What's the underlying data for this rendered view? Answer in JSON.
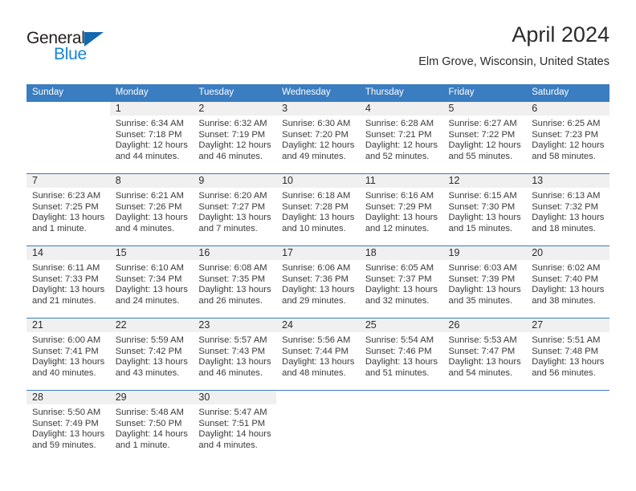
{
  "brand": {
    "name_part1": "General",
    "name_part2": "Blue",
    "accent_color": "#1583d4",
    "triangle_color": "#1269b0"
  },
  "header": {
    "title": "April 2024",
    "subtitle": "Elm Grove, Wisconsin, United States"
  },
  "theme": {
    "header_row_bg": "#3a7dc0",
    "daynum_band_bg": "#f0f0f0",
    "row_divider": "#3a7dc0"
  },
  "weekday_headers": [
    "Sunday",
    "Monday",
    "Tuesday",
    "Wednesday",
    "Thursday",
    "Friday",
    "Saturday"
  ],
  "weeks": [
    [
      {
        "day": "",
        "sunrise": "",
        "sunset": "",
        "daylight_line1": "",
        "daylight_line2": ""
      },
      {
        "day": "1",
        "sunrise": "Sunrise: 6:34 AM",
        "sunset": "Sunset: 7:18 PM",
        "daylight_line1": "Daylight: 12 hours",
        "daylight_line2": "and 44 minutes."
      },
      {
        "day": "2",
        "sunrise": "Sunrise: 6:32 AM",
        "sunset": "Sunset: 7:19 PM",
        "daylight_line1": "Daylight: 12 hours",
        "daylight_line2": "and 46 minutes."
      },
      {
        "day": "3",
        "sunrise": "Sunrise: 6:30 AM",
        "sunset": "Sunset: 7:20 PM",
        "daylight_line1": "Daylight: 12 hours",
        "daylight_line2": "and 49 minutes."
      },
      {
        "day": "4",
        "sunrise": "Sunrise: 6:28 AM",
        "sunset": "Sunset: 7:21 PM",
        "daylight_line1": "Daylight: 12 hours",
        "daylight_line2": "and 52 minutes."
      },
      {
        "day": "5",
        "sunrise": "Sunrise: 6:27 AM",
        "sunset": "Sunset: 7:22 PM",
        "daylight_line1": "Daylight: 12 hours",
        "daylight_line2": "and 55 minutes."
      },
      {
        "day": "6",
        "sunrise": "Sunrise: 6:25 AM",
        "sunset": "Sunset: 7:23 PM",
        "daylight_line1": "Daylight: 12 hours",
        "daylight_line2": "and 58 minutes."
      }
    ],
    [
      {
        "day": "7",
        "sunrise": "Sunrise: 6:23 AM",
        "sunset": "Sunset: 7:25 PM",
        "daylight_line1": "Daylight: 13 hours",
        "daylight_line2": "and 1 minute."
      },
      {
        "day": "8",
        "sunrise": "Sunrise: 6:21 AM",
        "sunset": "Sunset: 7:26 PM",
        "daylight_line1": "Daylight: 13 hours",
        "daylight_line2": "and 4 minutes."
      },
      {
        "day": "9",
        "sunrise": "Sunrise: 6:20 AM",
        "sunset": "Sunset: 7:27 PM",
        "daylight_line1": "Daylight: 13 hours",
        "daylight_line2": "and 7 minutes."
      },
      {
        "day": "10",
        "sunrise": "Sunrise: 6:18 AM",
        "sunset": "Sunset: 7:28 PM",
        "daylight_line1": "Daylight: 13 hours",
        "daylight_line2": "and 10 minutes."
      },
      {
        "day": "11",
        "sunrise": "Sunrise: 6:16 AM",
        "sunset": "Sunset: 7:29 PM",
        "daylight_line1": "Daylight: 13 hours",
        "daylight_line2": "and 12 minutes."
      },
      {
        "day": "12",
        "sunrise": "Sunrise: 6:15 AM",
        "sunset": "Sunset: 7:30 PM",
        "daylight_line1": "Daylight: 13 hours",
        "daylight_line2": "and 15 minutes."
      },
      {
        "day": "13",
        "sunrise": "Sunrise: 6:13 AM",
        "sunset": "Sunset: 7:32 PM",
        "daylight_line1": "Daylight: 13 hours",
        "daylight_line2": "and 18 minutes."
      }
    ],
    [
      {
        "day": "14",
        "sunrise": "Sunrise: 6:11 AM",
        "sunset": "Sunset: 7:33 PM",
        "daylight_line1": "Daylight: 13 hours",
        "daylight_line2": "and 21 minutes."
      },
      {
        "day": "15",
        "sunrise": "Sunrise: 6:10 AM",
        "sunset": "Sunset: 7:34 PM",
        "daylight_line1": "Daylight: 13 hours",
        "daylight_line2": "and 24 minutes."
      },
      {
        "day": "16",
        "sunrise": "Sunrise: 6:08 AM",
        "sunset": "Sunset: 7:35 PM",
        "daylight_line1": "Daylight: 13 hours",
        "daylight_line2": "and 26 minutes."
      },
      {
        "day": "17",
        "sunrise": "Sunrise: 6:06 AM",
        "sunset": "Sunset: 7:36 PM",
        "daylight_line1": "Daylight: 13 hours",
        "daylight_line2": "and 29 minutes."
      },
      {
        "day": "18",
        "sunrise": "Sunrise: 6:05 AM",
        "sunset": "Sunset: 7:37 PM",
        "daylight_line1": "Daylight: 13 hours",
        "daylight_line2": "and 32 minutes."
      },
      {
        "day": "19",
        "sunrise": "Sunrise: 6:03 AM",
        "sunset": "Sunset: 7:39 PM",
        "daylight_line1": "Daylight: 13 hours",
        "daylight_line2": "and 35 minutes."
      },
      {
        "day": "20",
        "sunrise": "Sunrise: 6:02 AM",
        "sunset": "Sunset: 7:40 PM",
        "daylight_line1": "Daylight: 13 hours",
        "daylight_line2": "and 38 minutes."
      }
    ],
    [
      {
        "day": "21",
        "sunrise": "Sunrise: 6:00 AM",
        "sunset": "Sunset: 7:41 PM",
        "daylight_line1": "Daylight: 13 hours",
        "daylight_line2": "and 40 minutes."
      },
      {
        "day": "22",
        "sunrise": "Sunrise: 5:59 AM",
        "sunset": "Sunset: 7:42 PM",
        "daylight_line1": "Daylight: 13 hours",
        "daylight_line2": "and 43 minutes."
      },
      {
        "day": "23",
        "sunrise": "Sunrise: 5:57 AM",
        "sunset": "Sunset: 7:43 PM",
        "daylight_line1": "Daylight: 13 hours",
        "daylight_line2": "and 46 minutes."
      },
      {
        "day": "24",
        "sunrise": "Sunrise: 5:56 AM",
        "sunset": "Sunset: 7:44 PM",
        "daylight_line1": "Daylight: 13 hours",
        "daylight_line2": "and 48 minutes."
      },
      {
        "day": "25",
        "sunrise": "Sunrise: 5:54 AM",
        "sunset": "Sunset: 7:46 PM",
        "daylight_line1": "Daylight: 13 hours",
        "daylight_line2": "and 51 minutes."
      },
      {
        "day": "26",
        "sunrise": "Sunrise: 5:53 AM",
        "sunset": "Sunset: 7:47 PM",
        "daylight_line1": "Daylight: 13 hours",
        "daylight_line2": "and 54 minutes."
      },
      {
        "day": "27",
        "sunrise": "Sunrise: 5:51 AM",
        "sunset": "Sunset: 7:48 PM",
        "daylight_line1": "Daylight: 13 hours",
        "daylight_line2": "and 56 minutes."
      }
    ],
    [
      {
        "day": "28",
        "sunrise": "Sunrise: 5:50 AM",
        "sunset": "Sunset: 7:49 PM",
        "daylight_line1": "Daylight: 13 hours",
        "daylight_line2": "and 59 minutes."
      },
      {
        "day": "29",
        "sunrise": "Sunrise: 5:48 AM",
        "sunset": "Sunset: 7:50 PM",
        "daylight_line1": "Daylight: 14 hours",
        "daylight_line2": "and 1 minute."
      },
      {
        "day": "30",
        "sunrise": "Sunrise: 5:47 AM",
        "sunset": "Sunset: 7:51 PM",
        "daylight_line1": "Daylight: 14 hours",
        "daylight_line2": "and 4 minutes."
      },
      {
        "day": "",
        "sunrise": "",
        "sunset": "",
        "daylight_line1": "",
        "daylight_line2": ""
      },
      {
        "day": "",
        "sunrise": "",
        "sunset": "",
        "daylight_line1": "",
        "daylight_line2": ""
      },
      {
        "day": "",
        "sunrise": "",
        "sunset": "",
        "daylight_line1": "",
        "daylight_line2": ""
      },
      {
        "day": "",
        "sunrise": "",
        "sunset": "",
        "daylight_line1": "",
        "daylight_line2": ""
      }
    ]
  ]
}
